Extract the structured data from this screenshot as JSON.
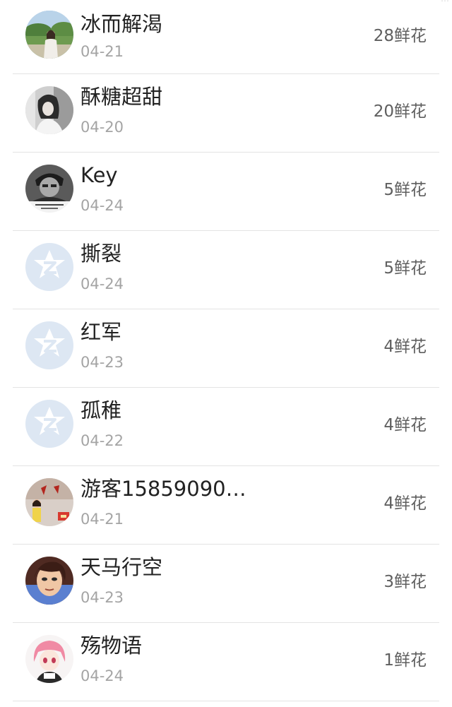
{
  "items": [
    {
      "name": "冰而解渴",
      "date": "04-21",
      "flowers": "28鲜花",
      "avatar": "photo-landscape-girl"
    },
    {
      "name": "酥糖超甜",
      "date": "04-20",
      "flowers": "20鲜花",
      "avatar": "photo-girl-bw"
    },
    {
      "name": "Key",
      "date": "04-24",
      "flowers": "5鲜花",
      "avatar": "photo-man-bw"
    },
    {
      "name": "撕裂",
      "date": "04-24",
      "flowers": "5鲜花",
      "avatar": "default-q-avatar"
    },
    {
      "name": "红军",
      "date": "04-23",
      "flowers": "4鲜花",
      "avatar": "default-q-avatar"
    },
    {
      "name": "孤稚",
      "date": "04-22",
      "flowers": "4鲜花",
      "avatar": "default-q-avatar"
    },
    {
      "name": "游客15859090…",
      "date": "04-21",
      "flowers": "4鲜花",
      "avatar": "photo-poster"
    },
    {
      "name": "天马行空",
      "date": "04-23",
      "flowers": "3鲜花",
      "avatar": "cartoon-face"
    },
    {
      "name": "殇物语",
      "date": "04-24",
      "flowers": "1鲜花",
      "avatar": "anime-girl"
    }
  ],
  "colors": {
    "name": "#222222",
    "date": "#a4a4a4",
    "flowers": "#5f5f5f",
    "divider": "#e3e3e3",
    "default_avatar_bg": "#dde7f3"
  }
}
